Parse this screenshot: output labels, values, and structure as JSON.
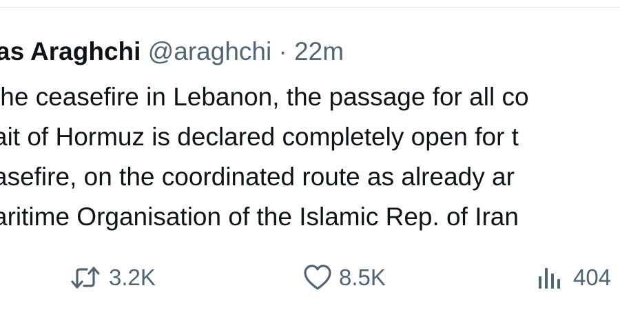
{
  "tweet": {
    "author_name": "as Araghchi",
    "author_handle": "@araghchi",
    "separator": "·",
    "time": "22m",
    "body_lines": [
      "the ceasefire in Lebanon, the passage for all co",
      "ait of Hormuz is declared completely open for t",
      "asefire, on the coordinated route as already ar",
      "aritime Organisation of the Islamic Rep. of Iran"
    ],
    "actions": {
      "retweet_count": "3.2K",
      "like_count": "8.5K",
      "views_count": "404"
    }
  },
  "icons": {
    "retweet": "retweet-icon",
    "like": "heart-icon",
    "views": "analytics-icon"
  },
  "colors": {
    "text_primary": "#0f1419",
    "text_secondary": "#536471",
    "divider": "#e6e9eb",
    "background": "#ffffff"
  }
}
